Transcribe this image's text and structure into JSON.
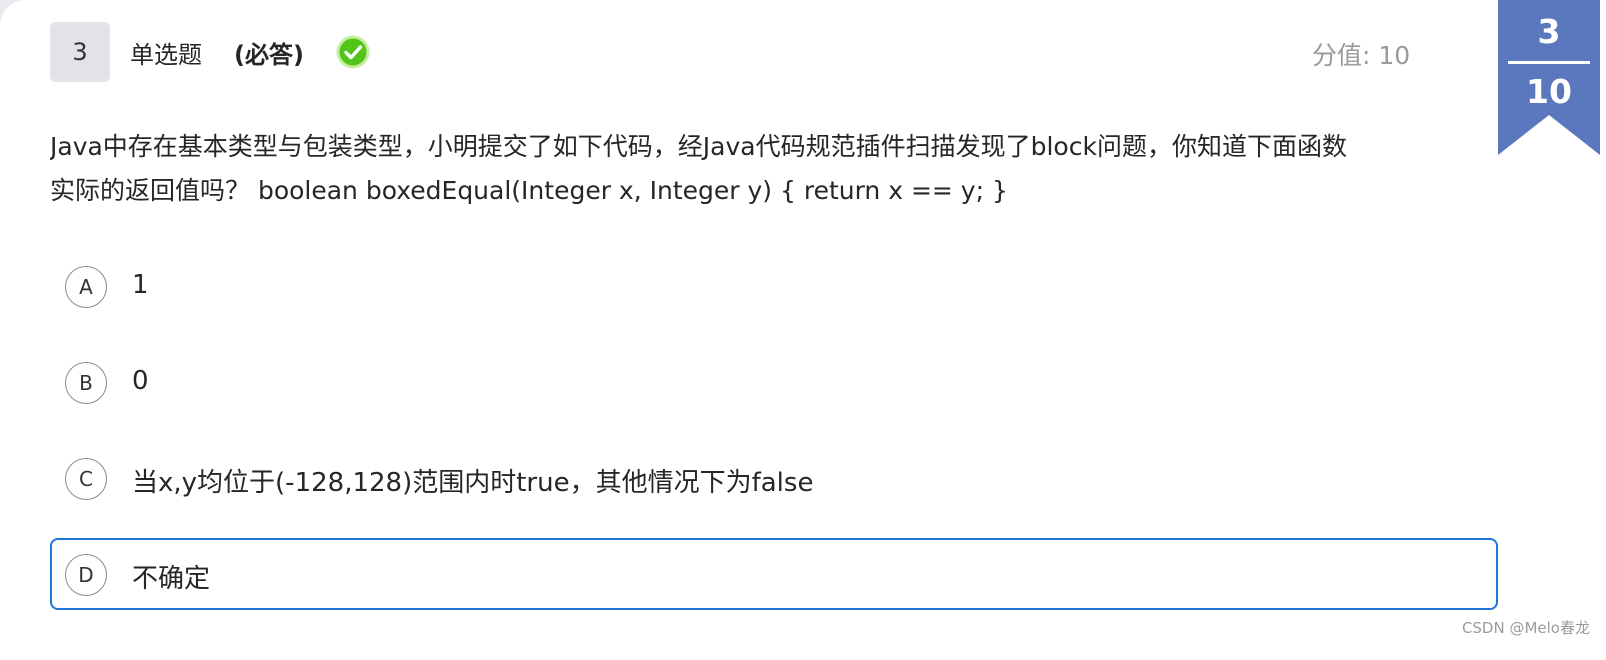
{
  "question": {
    "number": "3",
    "type": "单选题",
    "required": "(必答)",
    "status_icon": "check-circle-icon",
    "score_label": "分值: 10"
  },
  "progress": {
    "current": "3",
    "total": "10",
    "ribbon_color": "#5b78be"
  },
  "stem": {
    "line1": "Java中存在基本类型与包装类型，小明提交了如下代码，经Java代码规范插件扫描发现了block问题，你知道下面函数",
    "line2": "实际的返回值吗？  boolean boxedEqual(Integer x, Integer y) { return x == y; }"
  },
  "options": [
    {
      "letter": "A",
      "text": "1"
    },
    {
      "letter": "B",
      "text": "0"
    },
    {
      "letter": "C",
      "text": "当x,y均位于(-128,128)范围内时true，其他情况下为false"
    },
    {
      "letter": "D",
      "text": "不确定"
    }
  ],
  "selected_option": "D",
  "colors": {
    "accent": "#1f76d8",
    "check_green": "#52c41a"
  },
  "watermark": "CSDN @Melo春龙"
}
